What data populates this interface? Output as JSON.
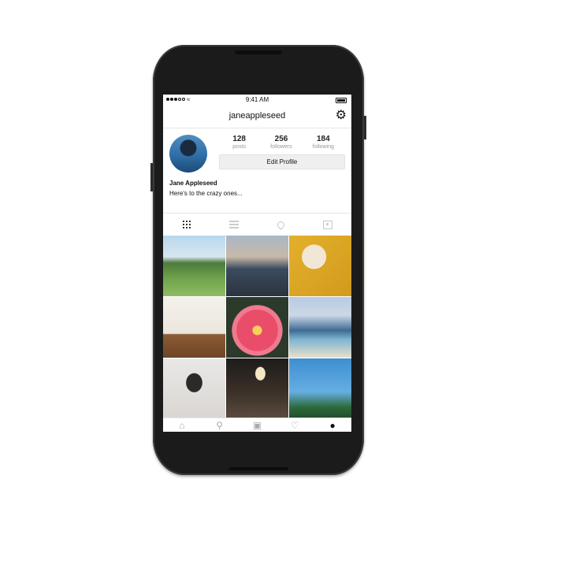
{
  "status_bar": {
    "time": "9:41 AM"
  },
  "nav": {
    "username": "janeappleseed"
  },
  "profile": {
    "stats": [
      {
        "value": "128",
        "label": "posts"
      },
      {
        "value": "256",
        "label": "followers"
      },
      {
        "value": "184",
        "label": "following"
      }
    ],
    "edit_button": "Edit Profile",
    "full_name": "Jane Appleseed",
    "bio": "Here's to the crazy ones..."
  },
  "tabs": [
    "grid-icon",
    "list-icon",
    "location-pin-icon",
    "tagged-photos-icon"
  ],
  "bottom_nav": [
    "home-icon",
    "search-icon",
    "camera-icon",
    "heart-icon",
    "profile-icon"
  ],
  "colors": {
    "screen_bg": "#ffffff",
    "button_bg": "#efefef",
    "phone_body": "#1b1b1b"
  }
}
